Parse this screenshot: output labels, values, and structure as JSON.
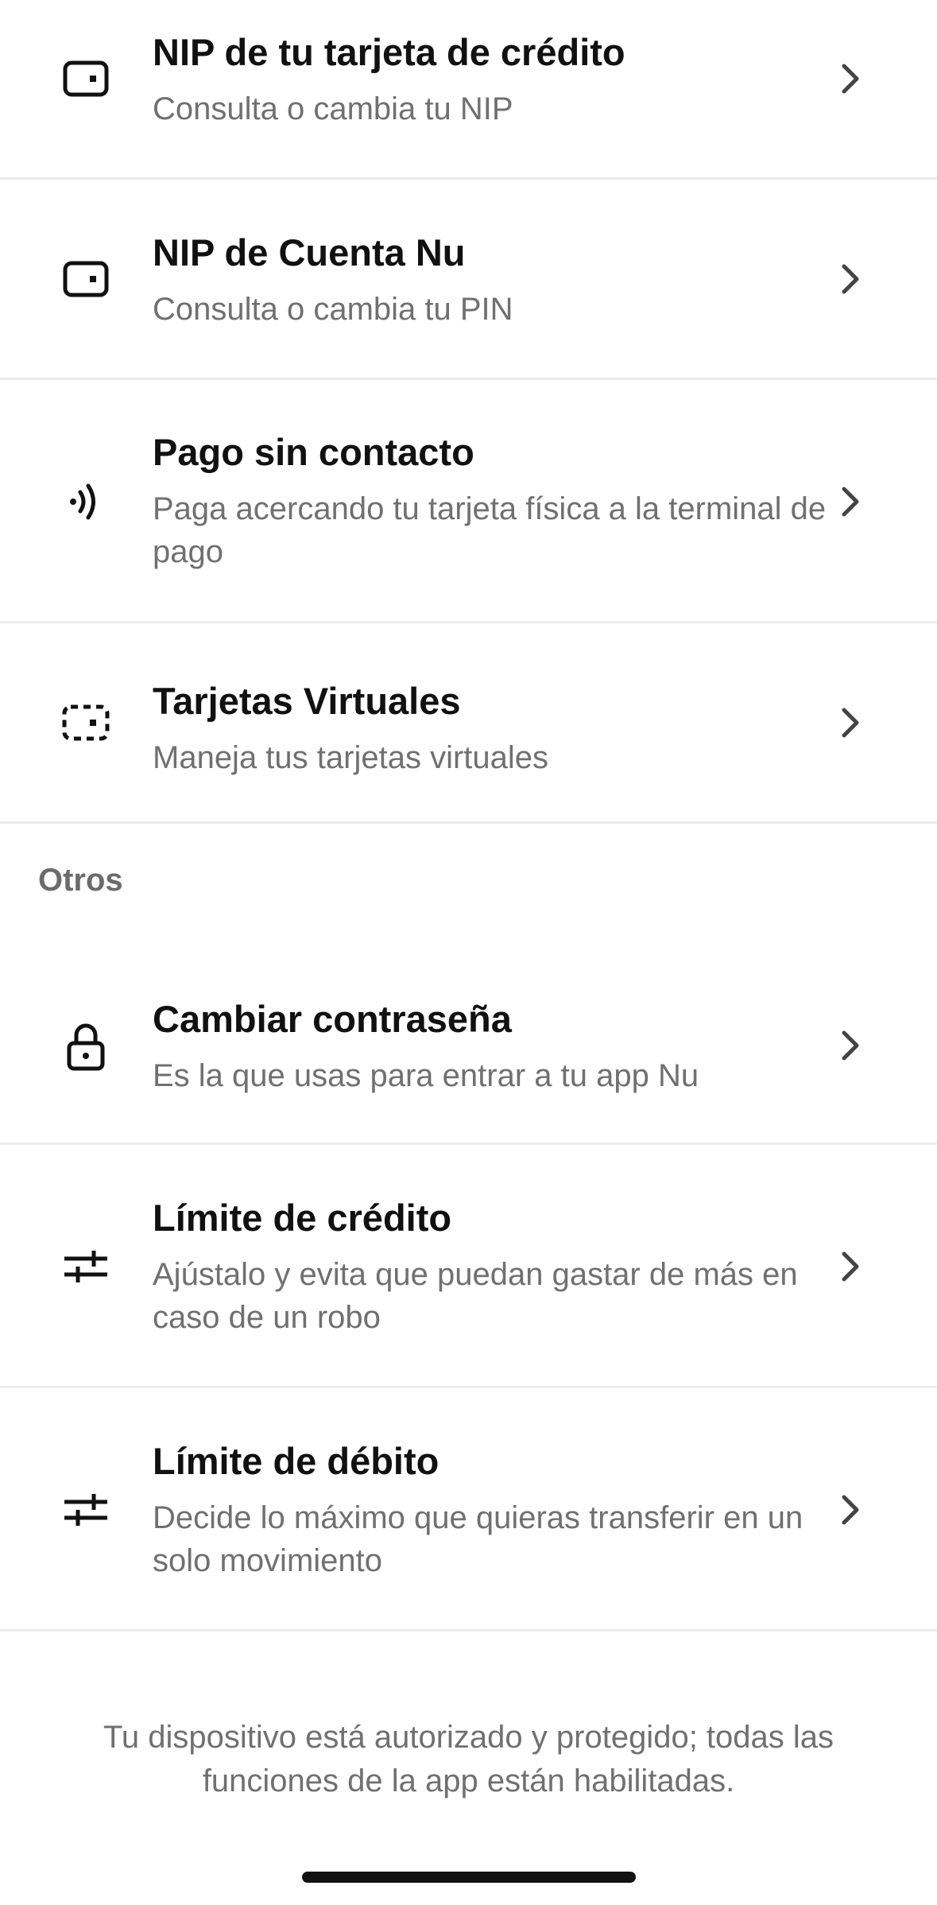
{
  "rows_top": [
    {
      "title": "NIP de tu tarjeta de crédito",
      "subtitle": "Consulta o cambia tu NIP",
      "icon": "card-icon"
    },
    {
      "title": "NIP de Cuenta Nu",
      "subtitle": "Consulta o cambia tu PIN",
      "icon": "card-icon"
    },
    {
      "title": "Pago sin contacto",
      "subtitle": "Paga acercando tu tarjeta física a la terminal de pago",
      "icon": "contactless-icon"
    },
    {
      "title": "Tarjetas Virtuales",
      "subtitle": "Maneja tus tarjetas virtuales",
      "icon": "virtual-card-icon"
    }
  ],
  "section_others": "Otros",
  "rows_others": [
    {
      "title": "Cambiar contraseña",
      "subtitle": "Es la que usas para entrar a tu app Nu",
      "icon": "lock-icon"
    },
    {
      "title": "Límite de crédito",
      "subtitle": "Ajústalo y evita que puedan gastar de más en caso de un robo",
      "icon": "sliders-icon"
    },
    {
      "title": "Límite de débito",
      "subtitle": "Decide lo máximo que quieras transferir en un solo movimiento",
      "icon": "sliders-icon"
    }
  ],
  "footer": "Tu dispositivo está autorizado y protegido; todas las funciones de la app están habilitadas."
}
